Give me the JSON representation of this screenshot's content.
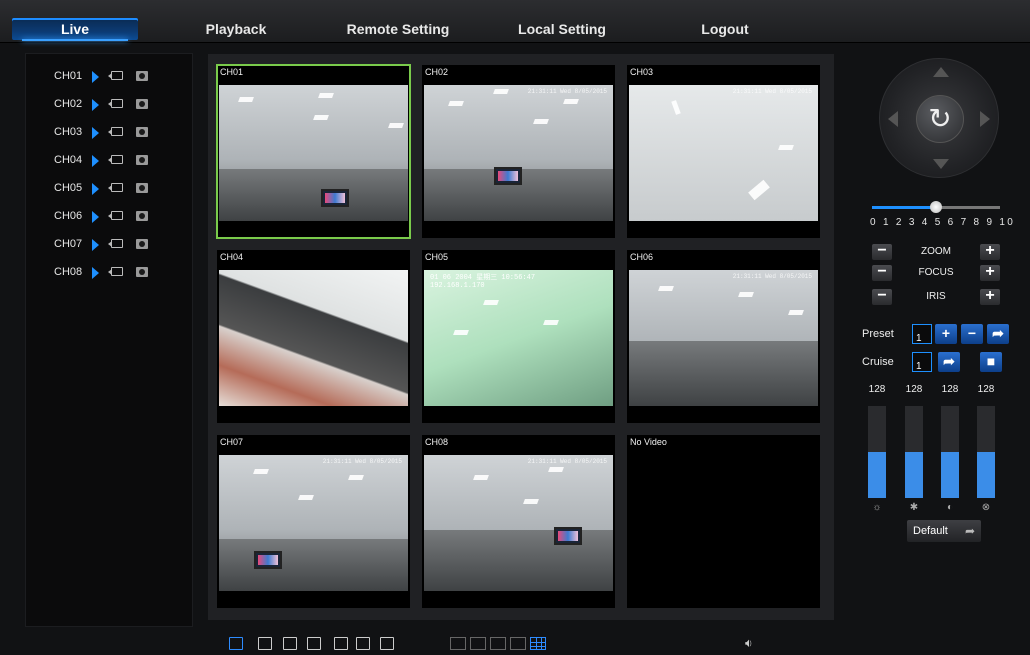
{
  "nav": {
    "tabs": [
      {
        "label": "Live",
        "active": true
      },
      {
        "label": "Playback"
      },
      {
        "label": "Remote Setting"
      },
      {
        "label": "Local Setting"
      },
      {
        "label": "Logout"
      }
    ]
  },
  "channels": [
    "CH01",
    "CH02",
    "CH03",
    "CH04",
    "CH05",
    "CH06",
    "CH07",
    "CH08"
  ],
  "grid": {
    "cells": [
      {
        "label": "CH01",
        "selected": true
      },
      {
        "label": "CH02"
      },
      {
        "label": "CH03"
      },
      {
        "label": "CH04"
      },
      {
        "label": "CH05",
        "osd": "01 06 2004 星期三 10:56:47",
        "osd2": "192.168.1.170"
      },
      {
        "label": "CH06"
      },
      {
        "label": "CH07"
      },
      {
        "label": "CH08"
      },
      {
        "label": "No Video"
      }
    ]
  },
  "ptz": {
    "speed_scale": "0 1 2 3 4 5 6 7 8 9 10",
    "speed_value": 5,
    "zoom_label": "ZOOM",
    "focus_label": "FOCUS",
    "iris_label": "IRIS",
    "preset_label": "Preset",
    "preset_value": "1",
    "cruise_label": "Cruise",
    "cruise_value": "1",
    "adjustments": [
      {
        "value": "128",
        "icon": "brightness-icon",
        "level": 0.5
      },
      {
        "value": "128",
        "icon": "contrast-star-icon",
        "level": 0.5
      },
      {
        "value": "128",
        "icon": "saturation-icon",
        "level": 0.5
      },
      {
        "value": "128",
        "icon": "hue-icon",
        "level": 0.5
      }
    ],
    "default_label": "Default"
  },
  "colors": {
    "accent": "#1e90ff",
    "selected_border": "#7acb4b"
  }
}
